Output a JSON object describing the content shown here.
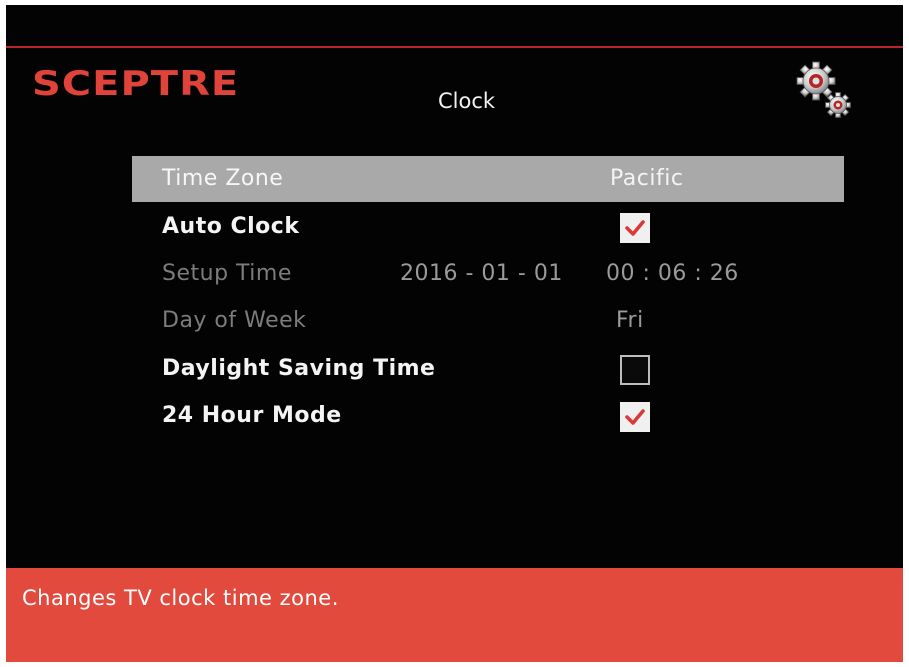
{
  "brand": {
    "logo_text": "SCEPTRE",
    "accent_color": "#e0433a"
  },
  "header": {
    "title": "Clock",
    "settings_icon": "gear-icon"
  },
  "menu": {
    "time_zone": {
      "label": "Time Zone",
      "value": "Pacific"
    },
    "auto_clock": {
      "label": "Auto Clock",
      "checked": true
    },
    "setup_time": {
      "label": "Setup Time",
      "date": "2016 - 01 - 01",
      "time": "00 : 06 : 26"
    },
    "day_of_week": {
      "label": "Day of Week",
      "value": "Fri"
    },
    "daylight_saving": {
      "label": "Daylight Saving Time",
      "checked": false
    },
    "hour_mode_24": {
      "label": "24 Hour Mode",
      "checked": true
    }
  },
  "status": {
    "help_text": "Changes TV clock time zone."
  }
}
